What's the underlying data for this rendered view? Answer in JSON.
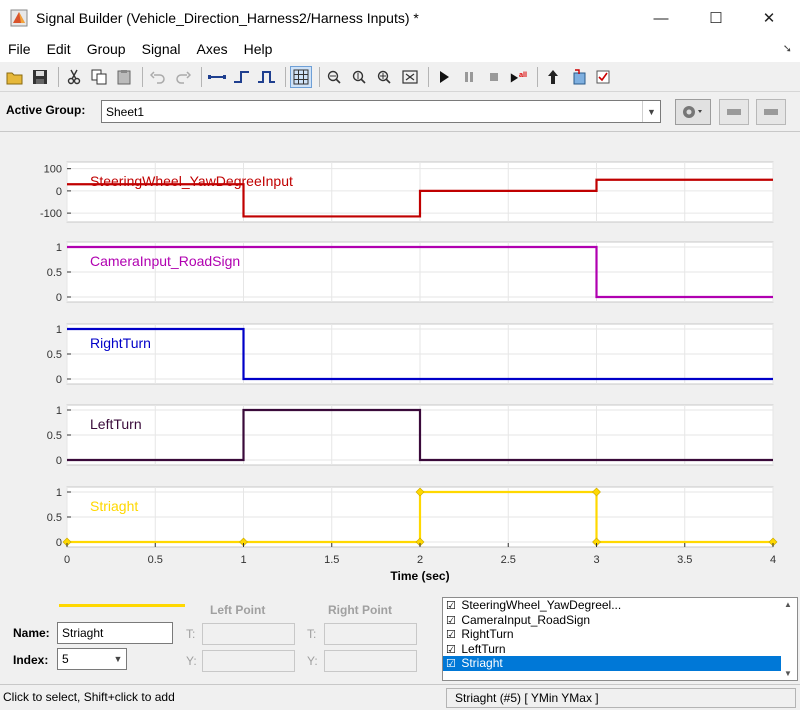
{
  "window": {
    "title": "Signal Builder (Vehicle_Direction_Harness2/Harness Inputs) *",
    "minimize": "—",
    "maximize": "☐",
    "close": "✕"
  },
  "menu": [
    "File",
    "Edit",
    "Group",
    "Signal",
    "Axes",
    "Help"
  ],
  "toolbar": {
    "icons": [
      "open-icon",
      "save-icon",
      "cut-icon",
      "copy-icon",
      "paste-icon",
      "undo-icon",
      "redo-icon",
      "constant-icon",
      "step-icon",
      "pulse-icon",
      "grid-icon",
      "zoom-x-icon",
      "zoom-y-icon",
      "zoom-xy-icon",
      "fit-icon",
      "start-icon",
      "pause-icon",
      "stop-icon",
      "run-all-icon",
      "up-icon",
      "export-icon",
      "check-icon"
    ]
  },
  "group": {
    "label": "Active Group:",
    "value": "Sheet1"
  },
  "axes": {
    "xlabel": "Time (sec)",
    "xticks": [
      "0",
      "0.5",
      "1",
      "1.5",
      "2",
      "2.5",
      "3",
      "3.5",
      "4"
    ]
  },
  "chart_data": [
    {
      "type": "line",
      "series": [
        {
          "name": "SteeringWheel_YawDegreeInput",
          "color": "#c00000",
          "x": [
            0,
            1,
            1,
            2,
            2,
            3,
            3,
            4
          ],
          "y": [
            30,
            30,
            -115,
            -115,
            0,
            0,
            50,
            50
          ]
        }
      ],
      "yticks": [
        "100",
        "0",
        "-100"
      ],
      "ylim": [
        -140,
        130
      ]
    },
    {
      "type": "line",
      "series": [
        {
          "name": "CameraInput_RoadSign",
          "color": "#b000b0",
          "x": [
            0,
            3,
            3,
            4
          ],
          "y": [
            1,
            1,
            0,
            0
          ]
        }
      ],
      "yticks": [
        "1",
        "0.5",
        "0"
      ],
      "ylim": [
        -0.1,
        1.1
      ]
    },
    {
      "type": "line",
      "series": [
        {
          "name": "RightTurn",
          "color": "#0000c8",
          "x": [
            0,
            1,
            1,
            4
          ],
          "y": [
            1,
            1,
            0,
            0
          ]
        }
      ],
      "yticks": [
        "1",
        "0.5",
        "0"
      ],
      "ylim": [
        -0.1,
        1.1
      ]
    },
    {
      "type": "line",
      "series": [
        {
          "name": "LeftTurn",
          "color": "#3a0a3a",
          "x": [
            0,
            1,
            1,
            2,
            2,
            4
          ],
          "y": [
            0,
            0,
            1,
            1,
            0,
            0
          ]
        }
      ],
      "yticks": [
        "1",
        "0.5",
        "0"
      ],
      "ylim": [
        -0.1,
        1.1
      ]
    },
    {
      "type": "line",
      "series": [
        {
          "name": "Striaght",
          "color": "#ffd800",
          "x": [
            0,
            1,
            2,
            2,
            3,
            3,
            4
          ],
          "y": [
            0,
            0,
            0,
            1,
            1,
            0,
            0
          ]
        }
      ],
      "yticks": [
        "1",
        "0.5",
        "0"
      ],
      "ylim": [
        -0.1,
        1.1
      ]
    }
  ],
  "point_editor": {
    "left_point": "Left Point",
    "right_point": "Right Point",
    "t_label": "T:",
    "y_label": "Y:",
    "name_label": "Name:",
    "name_value": "Striaght",
    "index_label": "Index:",
    "index_value": "5",
    "line_color": "#ffd800"
  },
  "signal_list": [
    {
      "label": "SteeringWheel_YawDegreel...",
      "checked": true,
      "selected": false
    },
    {
      "label": "CameraInput_RoadSign",
      "checked": true,
      "selected": false
    },
    {
      "label": "RightTurn",
      "checked": true,
      "selected": false
    },
    {
      "label": "LeftTurn",
      "checked": true,
      "selected": false
    },
    {
      "label": "Striaght",
      "checked": true,
      "selected": true
    }
  ],
  "status": {
    "left": "Click to select, Shift+click to add",
    "right": "Striaght (#5)  [ YMin YMax ]"
  }
}
